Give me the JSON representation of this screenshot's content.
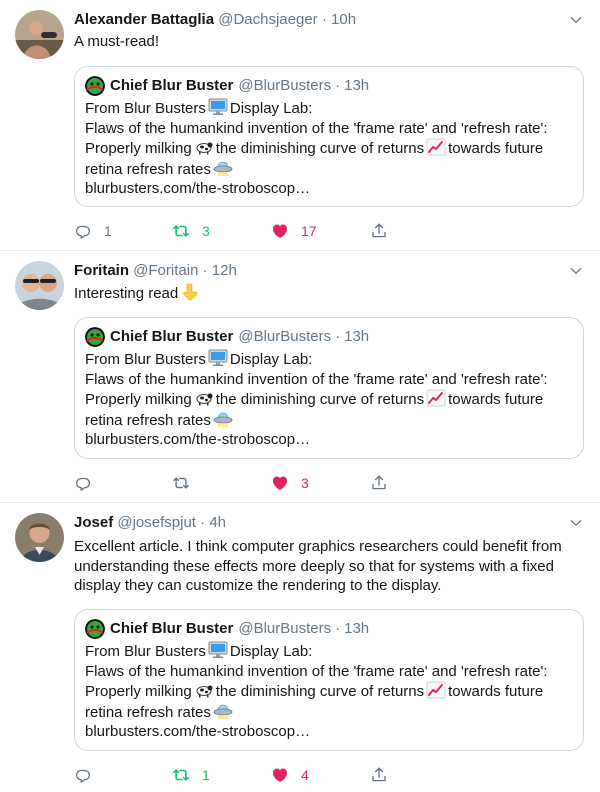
{
  "colors": {
    "accent": "#1da1f2",
    "retweet_green": "#17bf63",
    "like_red": "#e0245e",
    "muted": "#657786",
    "border": "#ccd6dd"
  },
  "quoted": {
    "name": "Chief Blur Buster",
    "handle": "@BlurBusters",
    "sep": "·",
    "time": "13h",
    "line1_a": "From Blur Busters",
    "line1_b": "Display Lab:",
    "line2": "Flaws of the humankind invention of the 'frame rate' and 'refresh rate':",
    "line3_a": "Properly milking",
    "line3_b": "the diminishing curve of returns",
    "line3_c": "towards future",
    "line4": "retina refresh rates",
    "link": "blurbusters.com/the-stroboscop…",
    "emoji_names": [
      "computer-icon",
      "cow-icon",
      "chart-increasing-icon",
      "ufo-icon"
    ]
  },
  "tweets": [
    {
      "name": "Alexander Battaglia",
      "handle": "@Dachsjaeger",
      "sep": "·",
      "time": "10h",
      "text": "A must-read!",
      "reply_count": "1",
      "retweet_count": "3",
      "like_count": "17",
      "retweeted": true,
      "liked": true
    },
    {
      "name": "Foritain",
      "handle": "@Foritain",
      "sep": "·",
      "time": "12h",
      "text": "Interesting read",
      "emoji": "pointing-down-icon",
      "reply_count": "",
      "retweet_count": "",
      "like_count": "3",
      "retweeted": false,
      "liked": true
    },
    {
      "name": "Josef",
      "handle": "@josefspjut",
      "sep": "·",
      "time": "4h",
      "text_lines": [
        "Excellent article. I think computer graphics researchers could benefit from",
        "understanding these effects more deeply so that for systems with a fixed",
        "display they can customize the rendering to the display."
      ],
      "reply_count": "",
      "retweet_count": "1",
      "like_count": "4",
      "retweeted": true,
      "liked": true
    }
  ]
}
